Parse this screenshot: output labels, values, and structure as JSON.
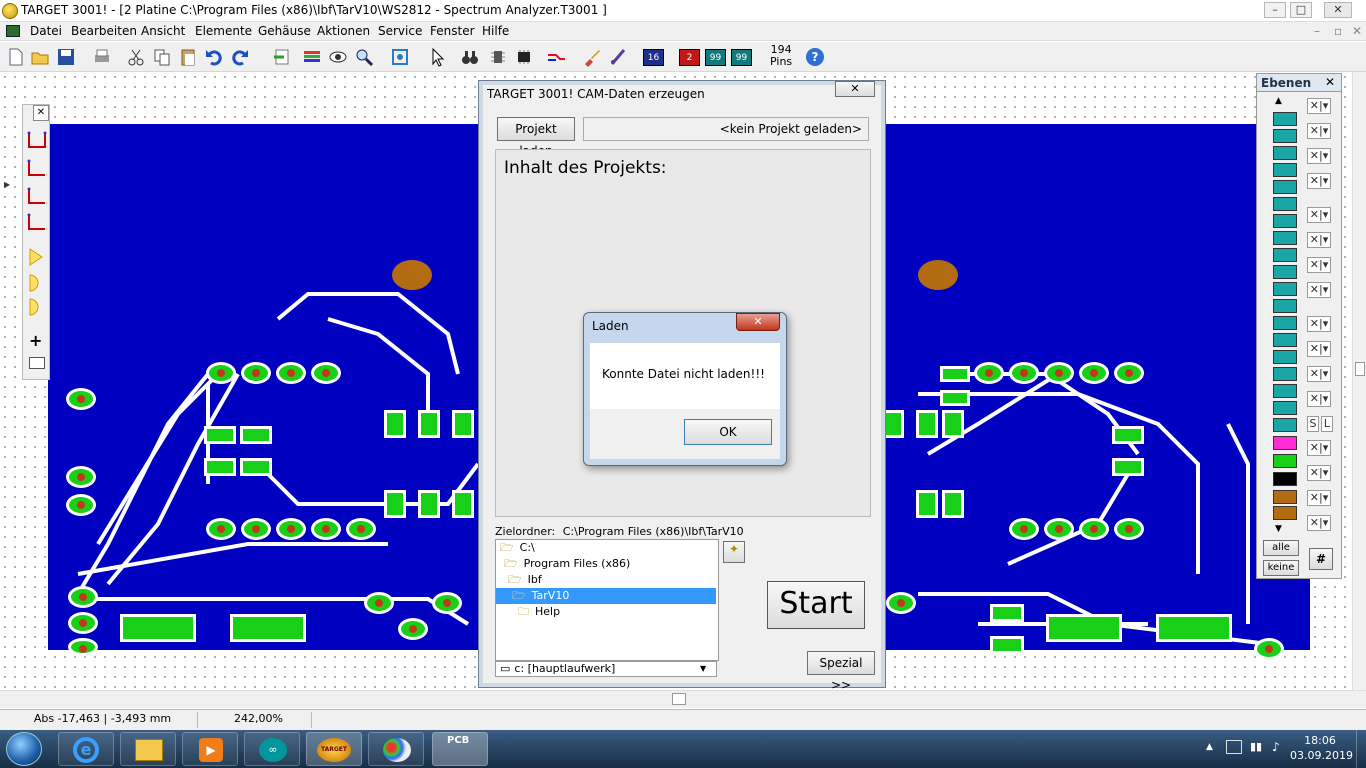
{
  "window": {
    "title": "TARGET 3001! - [2 Platine C:\\Program Files (x86)\\Ibf\\TarV10\\WS2812 - Spectrum Analyzer.T3001 ]",
    "minimize": "–",
    "maximize": "□",
    "close": "✕"
  },
  "menu": [
    "Datei",
    "Bearbeiten",
    "Ansicht",
    "Elemente",
    "Gehäuse",
    "Aktionen",
    "Service",
    "Fenster",
    "Hilfe"
  ],
  "toolbar": {
    "pins_count": "194",
    "pins_label": "Pins",
    "layer_16": "16",
    "layer_2": "2",
    "layer_99a": "99",
    "layer_99b": "99",
    "help": "?"
  },
  "layers_panel": {
    "title": "Ebenen",
    "close": "✕",
    "s_label": "S",
    "l_label": "L",
    "all": "alle",
    "none": "keine",
    "hash": "#"
  },
  "cam_dialog": {
    "title": "TARGET 3001! CAM-Daten erzeugen",
    "close": "✕",
    "load_project_button": "Projekt laden",
    "project_status": "<kein Projekt geladen>",
    "content_heading": "Inhalt des Projekts:",
    "target_folder_label": "Zielordner:",
    "target_folder_path": "C:\\Program Files (x86)\\Ibf\\TarV10",
    "tree": [
      "C:\\",
      "Program Files (x86)",
      "Ibf",
      "TarV10",
      "Help"
    ],
    "selected_folder": "TarV10",
    "drive": "c: [hauptlaufwerk]",
    "start_button": "Start",
    "special_button": "Spezial >>"
  },
  "error_dialog": {
    "title": "Laden",
    "message": "Konnte Datei nicht laden!!!",
    "ok_button": "OK",
    "close": "✕"
  },
  "statusbar": {
    "coords": "Abs -17,463 | -3,493 mm",
    "zoom": "242,00%"
  },
  "taskbar": {
    "time": "18:06",
    "date": "03.09.2019",
    "pcb_label": "PCB",
    "target_label": "TARGET"
  },
  "colors": {
    "board": "#0000c0",
    "copper": "#18d018",
    "hole": "#b36c12",
    "selection": "#3399ff"
  }
}
